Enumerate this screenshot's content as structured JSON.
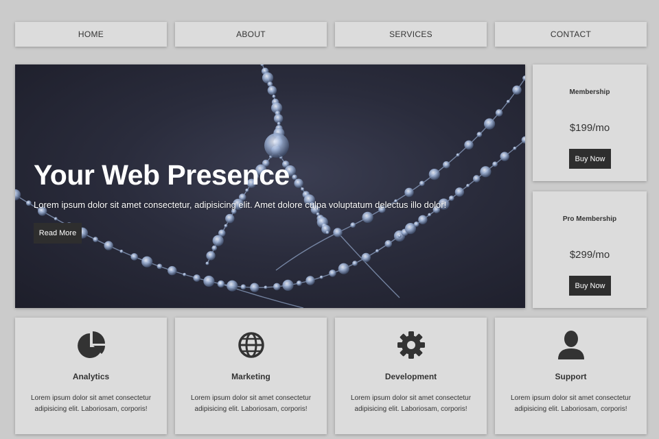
{
  "nav": {
    "items": [
      {
        "label": "HOME"
      },
      {
        "label": "ABOUT"
      },
      {
        "label": "SERVICES"
      },
      {
        "label": "CONTACT"
      }
    ]
  },
  "hero": {
    "title": "Your Web Presence",
    "text": "Lorem ipsum dolor sit amet consectetur, adipisicing elit. Amet dolore culpa voluptatum delectus illo dolor!",
    "button_label": "Read More"
  },
  "pricing": [
    {
      "title": "Membership",
      "price": "$199/mo",
      "button_label": "Buy Now"
    },
    {
      "title": "Pro Membership",
      "price": "$299/mo",
      "button_label": "Buy Now"
    }
  ],
  "features": [
    {
      "icon": "pie-chart-icon",
      "title": "Analytics",
      "text": "Lorem ipsum dolor sit amet consectetur adipisicing elit. Laboriosam, corporis!"
    },
    {
      "icon": "globe-icon",
      "title": "Marketing",
      "text": "Lorem ipsum dolor sit amet consectetur adipisicing elit. Laboriosam, corporis!"
    },
    {
      "icon": "gear-icon",
      "title": "Development",
      "text": "Lorem ipsum dolor sit amet consectetur adipisicing elit. Laboriosam, corporis!"
    },
    {
      "icon": "user-icon",
      "title": "Support",
      "text": "Lorem ipsum dolor sit amet consectetur adipisicing elit. Laboriosam, corporis!"
    }
  ],
  "colors": {
    "page_background": "#cbcbcb",
    "card_background": "#dcdcdc",
    "button_dark": "#2e2e2e",
    "text": "#333333",
    "hero_background": "#23242f"
  }
}
